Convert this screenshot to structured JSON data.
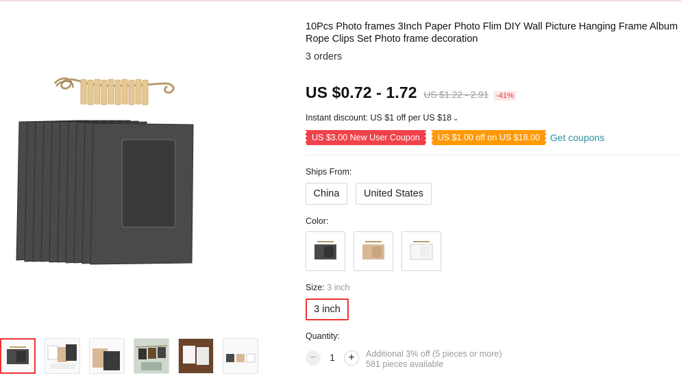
{
  "product": {
    "title": "10Pcs Photo frames 3Inch Paper Photo Flim DIY Wall Picture Hanging Frame Album Rope Clips Set Photo frame decoration",
    "orders": "3 orders"
  },
  "pricing": {
    "price": "US $0.72 - 1.72",
    "original_price": "US $1.22 - 2.91",
    "discount_badge": "-41%",
    "instant_discount": "Instant discount: US $1 off per US $18"
  },
  "coupons": {
    "new_user": "US $3.00 New User Coupon",
    "off": "US $1.00 off on US $18.00",
    "get_link": "Get coupons",
    "colors": {
      "red": "#f0424a",
      "orange": "#ff9906",
      "link": "#2a8fa0"
    }
  },
  "ships_from": {
    "label": "Ships From:",
    "options": [
      "China",
      "United States"
    ]
  },
  "color": {
    "label": "Color:",
    "swatches": [
      "black-frame-image",
      "kraft-frame-image",
      "white-frame-image"
    ]
  },
  "size": {
    "label": "Size:",
    "selected": "3 inch",
    "options": [
      "3 inch"
    ]
  },
  "quantity": {
    "label": "Quantity:",
    "value": "1",
    "minus": "−",
    "plus": "+",
    "info_line1": "Additional 3% off (5 pieces or more)",
    "info_line2": "581 pieces available"
  },
  "gallery": {
    "thumbs": [
      "black-frames-thumb",
      "mixed-frames-thumb",
      "kraft-black-thumb",
      "hanging-photos-thumb",
      "wall-display-thumb",
      "three-colors-thumb"
    ],
    "selected_index": 0
  },
  "accent": "#ee3333"
}
